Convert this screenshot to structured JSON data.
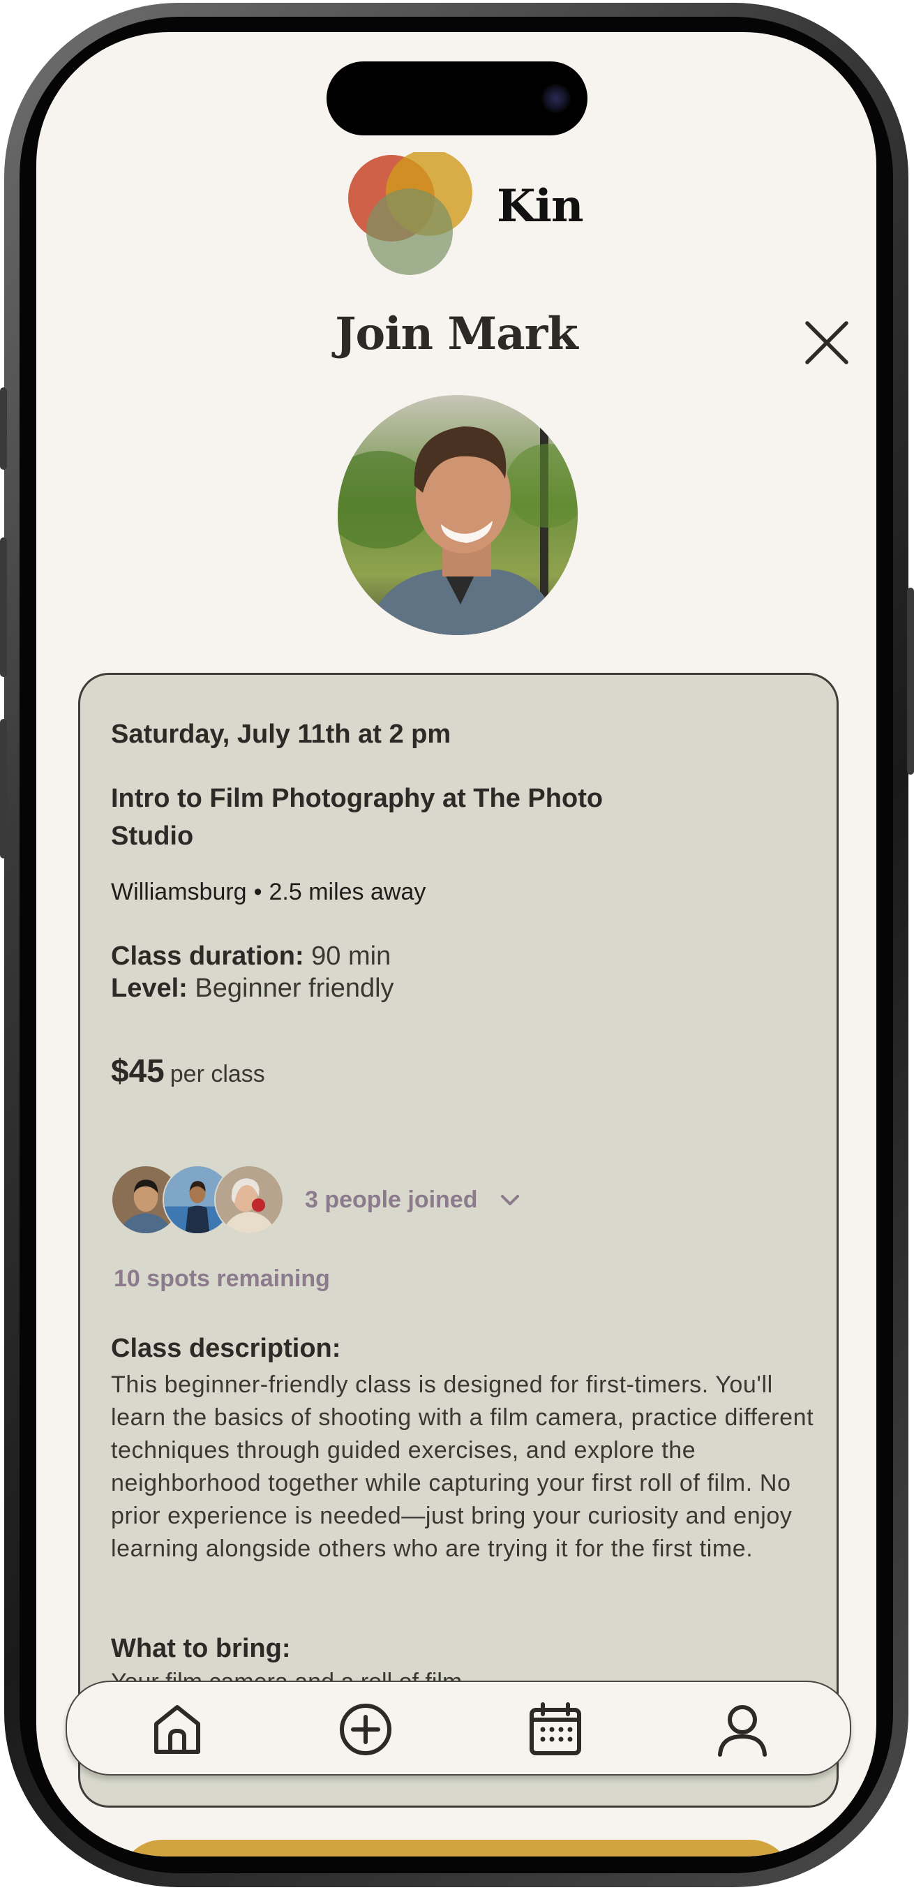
{
  "app": {
    "name": "Kin"
  },
  "header": {
    "title": "Join Mark",
    "close_icon": "close-icon",
    "logo_icon": "kin-logo-icon"
  },
  "host": {
    "photo": "host-avatar"
  },
  "event": {
    "date": "Saturday, July 11th at 2 pm",
    "title": "Intro to Film Photography at The Photo Studio",
    "neighborhood": "Williamsburg",
    "separator": "•",
    "distance": "2.5 miles away",
    "duration_label": "Class duration:",
    "duration_value": "90 min",
    "level_label": "Level:",
    "level_value": "Beginner friendly",
    "price": "$45",
    "price_unit": "per class",
    "joined_text": "3 people joined",
    "spots_text": "10 spots remaining",
    "description_heading": "Class description:",
    "description": "This beginner-friendly class is designed for first-timers. You'll learn the basics of shooting with a film camera, practice different techniques through guided exercises, and explore the neighborhood together while capturing your first roll of film. No prior experience is needed—just bring your curiosity and enjoy learning alongside others who are trying it for the first time.",
    "bring_heading": "What to bring:",
    "bring_text": "Your film camera and a roll of film"
  },
  "nav": {
    "items": [
      "home-icon",
      "add-circle-icon",
      "calendar-icon",
      "profile-icon"
    ]
  },
  "colors": {
    "background": "#f7f4ef",
    "card": "#d8d9cc",
    "accent_mauve": "#8c7b8c",
    "cta": "#d2a43f"
  }
}
